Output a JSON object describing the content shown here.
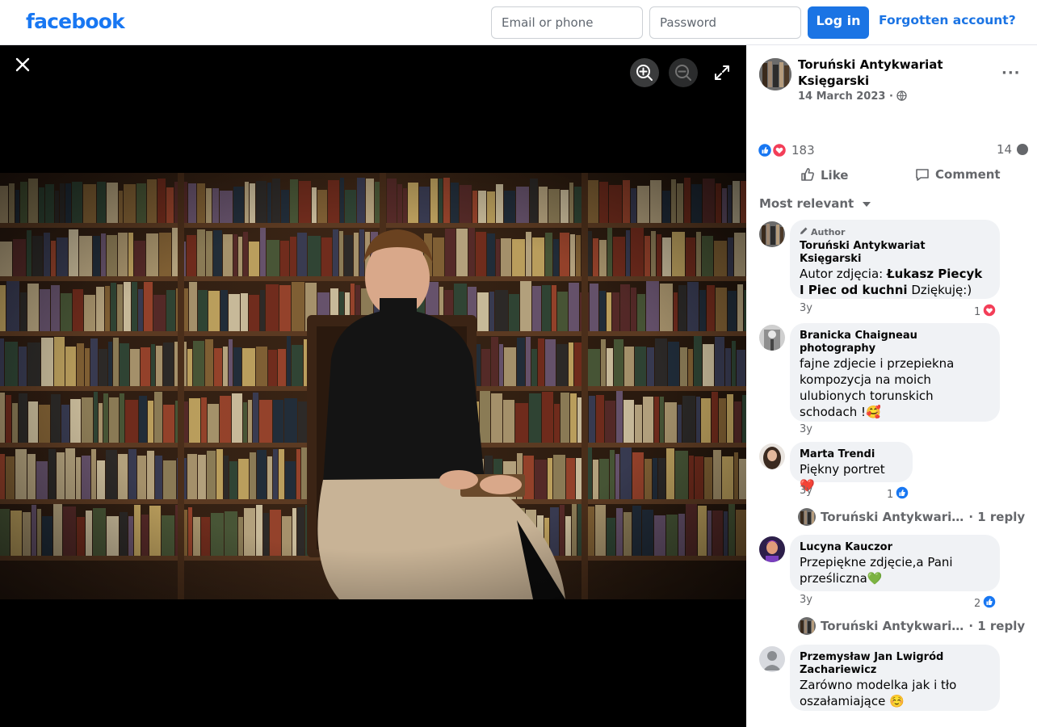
{
  "header": {
    "logo": "facebook",
    "email_placeholder": "Email or phone",
    "password_placeholder": "Password",
    "login_label": "Log in",
    "forgot_label": "Forgotten account?"
  },
  "viewer": {
    "close_icon": "close-icon",
    "zoom_in_icon": "zoom-in-icon",
    "zoom_out_icon": "zoom-out-icon",
    "fullscreen_icon": "fullscreen-icon"
  },
  "post": {
    "page_name": "Toruński Antykwariat Księgarski",
    "date": "14 March 2023",
    "privacy_separator": "·",
    "more_label": "···",
    "reaction_count": "183",
    "comment_count": "14",
    "like_label": "Like",
    "comment_label": "Comment",
    "sort_label": "Most relevant"
  },
  "comments": [
    {
      "badge": "Author",
      "author": "Toruński Antykwariat Księgarski",
      "text_pre": "Autor zdjęcia: ",
      "text_bold": "Łukasz Piecyk I Piec od kuchni",
      "text_post": " Dziękuję:)",
      "time": "3y",
      "reaction_count": "1"
    },
    {
      "author": "Branicka Chaigneau photography",
      "text": "fajne zdjecie i przepiekna kompozycja na moich ulubionych torunskich schodach !🥰",
      "time": "3y"
    },
    {
      "author": "Marta Trendi",
      "text": "Piękny portret ❤️",
      "time": "3y",
      "reaction_count": "1",
      "reply_name": "Toruński Antykwari…",
      "reply_label": "· 1 reply"
    },
    {
      "author": "Lucyna Kauczor",
      "text": "Przepiękne zdjęcie,a Pani prześliczna💚",
      "time": "3y",
      "reaction_count": "2",
      "reply_name": "Toruński Antykwari…",
      "reply_label": "· 1 reply"
    },
    {
      "author": "Przemysław Jan Lwigród Zachariewicz",
      "text": "Zarówno modelka jak i tło oszałamiające ☺️"
    }
  ],
  "colors": {
    "brand": "#1877f2",
    "button": "#1b74e4",
    "like_blue": "#1877f2",
    "love_red": "#f33e58",
    "secondary_text": "#65676b",
    "bubble": "#f0f2f5"
  }
}
